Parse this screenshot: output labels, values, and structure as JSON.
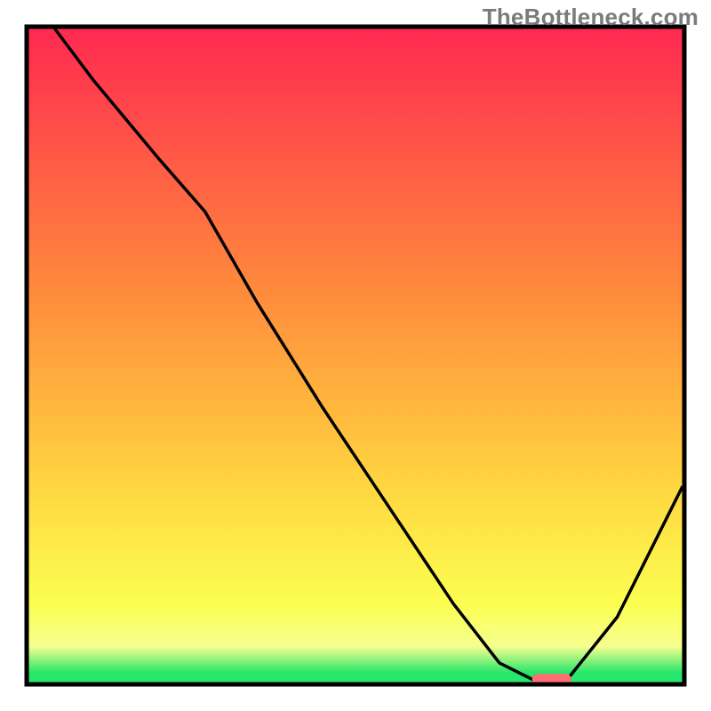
{
  "watermark": "TheBottleneck.com",
  "colors": {
    "frame_black": "#000000",
    "curve_black": "#000000",
    "marker_red": "#ff6d74",
    "marker_green": "#2dd36f",
    "grad_top": "#ff2950",
    "grad_mid1": "#ff8a3c",
    "grad_mid2": "#ffd640",
    "grad_yellow": "#fbff50",
    "grad_lemon": "#f6ff8f",
    "grad_green": "#27e66a"
  },
  "chart_data": {
    "type": "line",
    "title": "",
    "xlabel": "",
    "ylabel": "",
    "xlim": [
      0,
      100
    ],
    "ylim": [
      0,
      100
    ],
    "x": [
      4,
      10,
      20,
      27,
      35,
      45,
      55,
      65,
      72,
      78,
      82,
      90,
      100
    ],
    "values": [
      100,
      92,
      80,
      72,
      58,
      42,
      27,
      12,
      3,
      0,
      0,
      10,
      30
    ],
    "minimum_band": {
      "x_start": 77,
      "x_end": 83,
      "y": 0.5
    },
    "gradient_stops": [
      {
        "offset": 0.0,
        "value_hint": "worst",
        "color": "#ff2950"
      },
      {
        "offset": 0.4,
        "value_hint": "bad",
        "color": "#ff8a3c"
      },
      {
        "offset": 0.7,
        "value_hint": "mid",
        "color": "#ffd640"
      },
      {
        "offset": 0.88,
        "value_hint": "mid2",
        "color": "#fbff50"
      },
      {
        "offset": 0.945,
        "value_hint": "good",
        "color": "#f6ff8f"
      },
      {
        "offset": 0.985,
        "value_hint": "best",
        "color": "#27e66a"
      }
    ]
  }
}
